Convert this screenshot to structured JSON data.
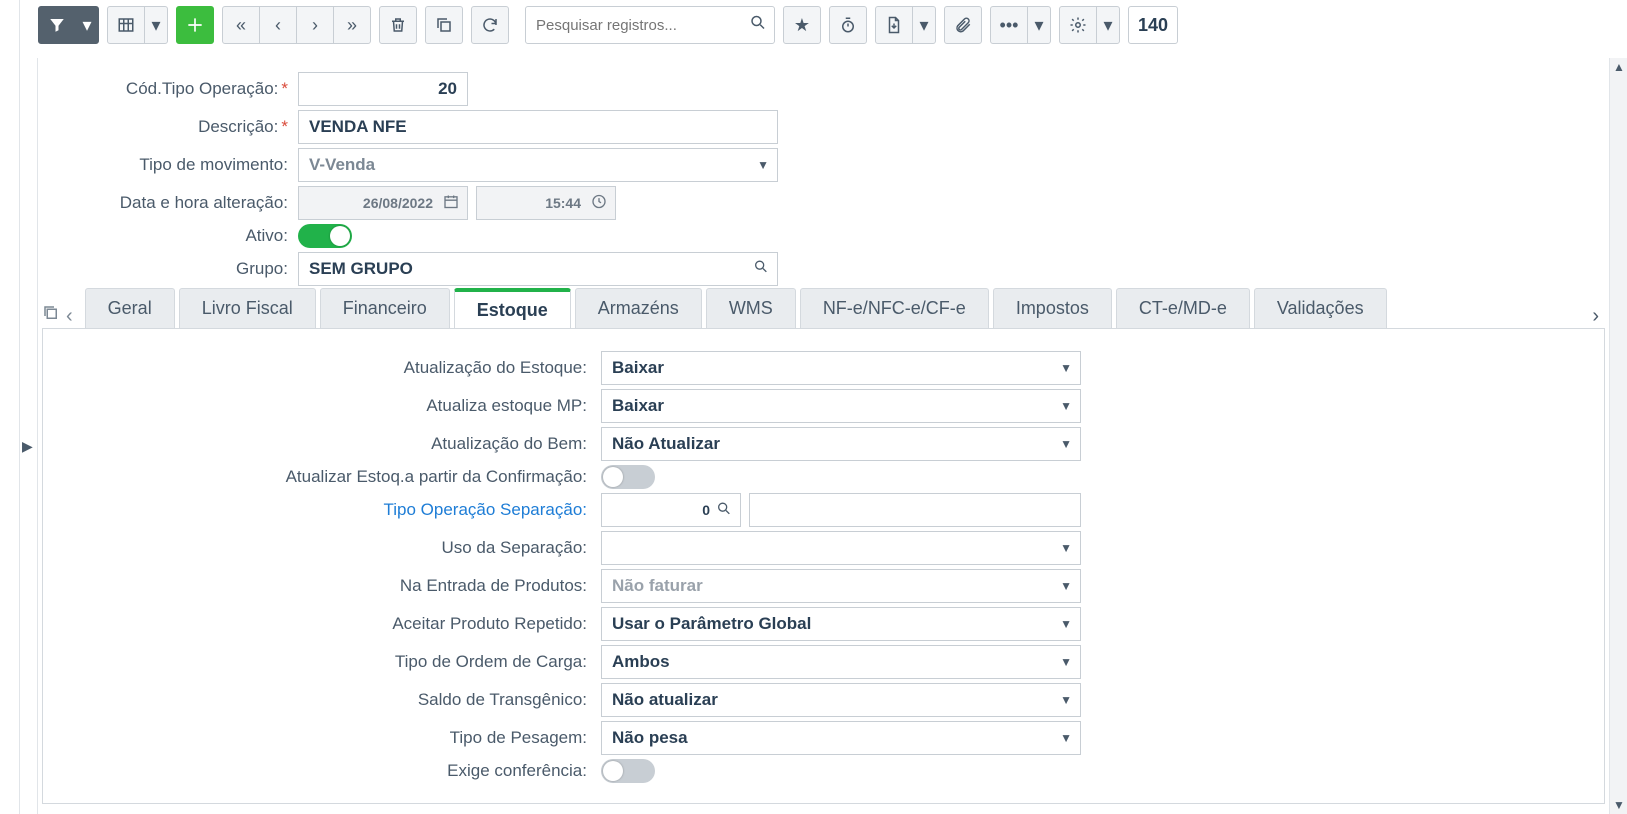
{
  "toolbar": {
    "search_placeholder": "Pesquisar registros...",
    "page_count": "140"
  },
  "header": {
    "labels": {
      "codigo": "Cód.Tipo Operação:",
      "descricao": "Descrição:",
      "tipo_mov": "Tipo de movimento:",
      "data_alt": "Data e hora alteração:",
      "ativo": "Ativo:",
      "grupo": "Grupo:"
    },
    "codigo": "20",
    "descricao": "VENDA NFE",
    "tipo_movimento": "V-Venda",
    "data": "26/08/2022",
    "hora": "15:44",
    "ativo": true,
    "grupo": "SEM GRUPO"
  },
  "tabs": [
    "Geral",
    "Livro Fiscal",
    "Financeiro",
    "Estoque",
    "Armazéns",
    "WMS",
    "NF-e/NFC-e/CF-e",
    "Impostos",
    "CT-e/MD-e",
    "Validações"
  ],
  "active_tab": "Estoque",
  "estoque": {
    "labels": {
      "atualizacao_estoque": "Atualização do Estoque:",
      "atualiza_estoque_mp": "Atualiza estoque MP:",
      "atualizacao_bem": "Atualização do Bem:",
      "atualizar_confirmacao": "Atualizar Estoq.a partir da Confirmação:",
      "tipo_operacao_sep": "Tipo Operação Separação:",
      "uso_separacao": "Uso da Separação:",
      "entrada_produtos": "Na Entrada de Produtos:",
      "aceitar_repetido": "Aceitar Produto Repetido:",
      "ordem_carga": "Tipo de Ordem de Carga:",
      "saldo_transgenico": "Saldo de Transgênico:",
      "tipo_pesagem": "Tipo de Pesagem:",
      "exige_conferencia": "Exige conferência:"
    },
    "atualizacao_estoque": "Baixar",
    "atualiza_estoque_mp": "Baixar",
    "atualizacao_bem": "Não Atualizar",
    "atualizar_confirmacao": false,
    "tipo_operacao_sep_valor": "0",
    "tipo_operacao_sep_desc": "",
    "uso_separacao": "",
    "entrada_produtos": "Não faturar",
    "aceitar_repetido": "Usar o Parâmetro Global",
    "ordem_carga": "Ambos",
    "saldo_transgenico": "Não atualizar",
    "tipo_pesagem": "Não pesa",
    "exige_conferencia": false
  }
}
